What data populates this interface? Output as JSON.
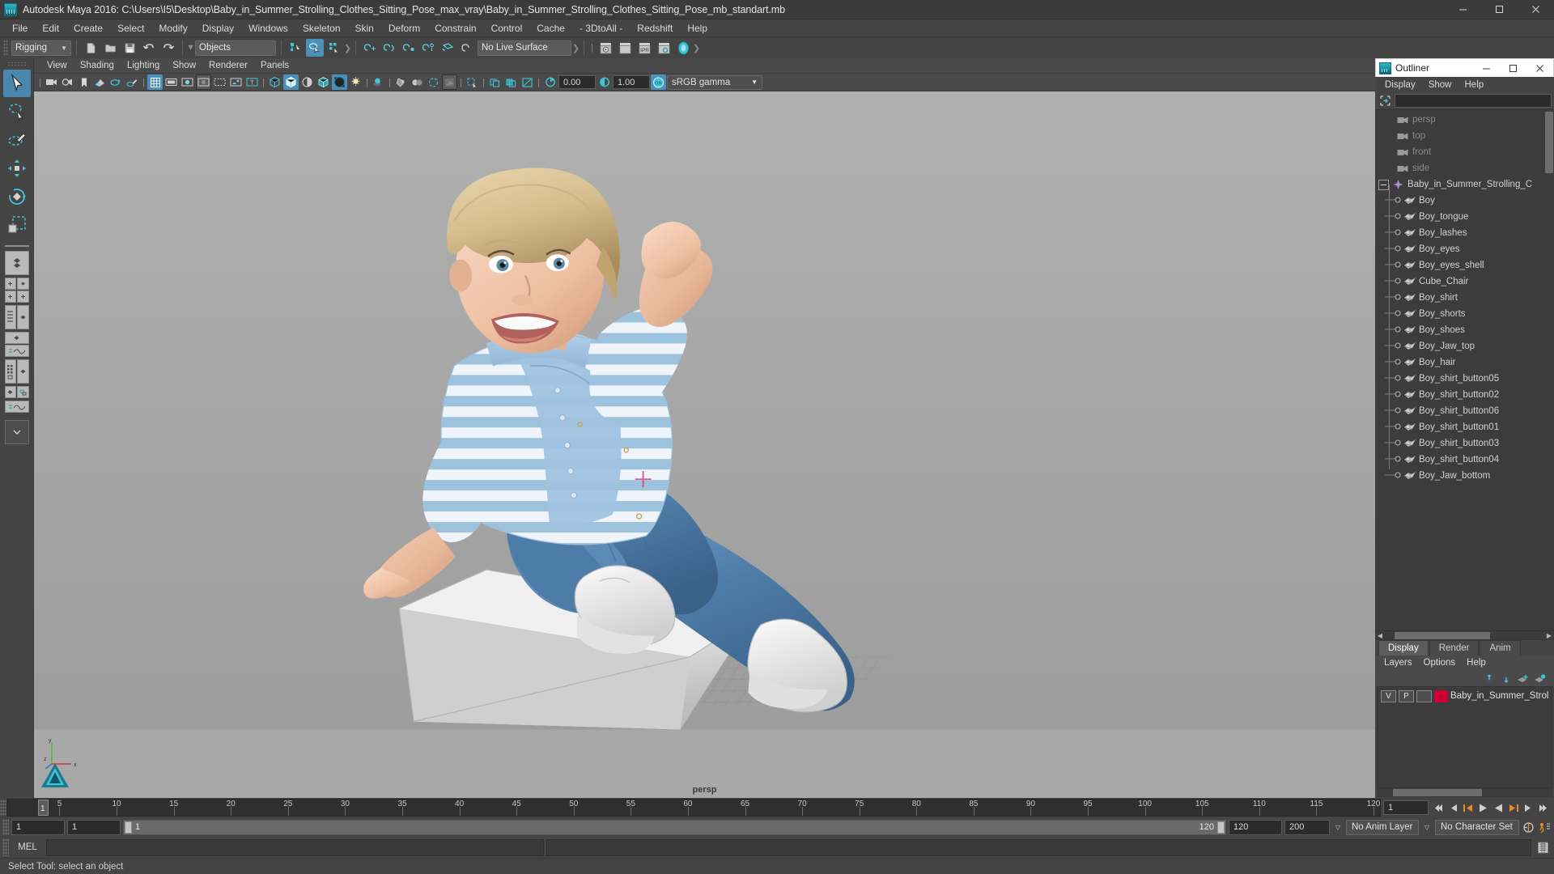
{
  "titlebar": {
    "title": "Autodesk Maya 2016: C:\\Users\\I5\\Desktop\\Baby_in_Summer_Strolling_Clothes_Sitting_Pose_max_vray\\Baby_in_Summer_Strolling_Clothes_Sitting_Pose_mb_standart.mb",
    "minimize": "–",
    "maximize": "❐",
    "close": "✕"
  },
  "menubar": {
    "items": [
      "File",
      "Edit",
      "Create",
      "Select",
      "Modify",
      "Display",
      "Windows",
      "Skeleton",
      "Skin",
      "Deform",
      "Constrain",
      "Control",
      "Cache",
      "- 3DtoAll -",
      "Redshift",
      "Help"
    ]
  },
  "statusbar": {
    "menuset": "Rigging",
    "selection_mask": "Objects",
    "live_surface": "No Live Surface",
    "icons": [
      "new-scene-icon",
      "open-scene-icon",
      "save-scene-icon",
      "undo-icon",
      "redo-icon",
      "select-by-hierarchy-icon",
      "select-by-object-icon",
      "select-by-component-icon",
      "snap-to-grid-icon",
      "snap-to-curve-icon",
      "snap-to-point-icon",
      "snap-to-projected-center-icon",
      "snap-to-view-plane-icon",
      "make-live-icon",
      "render-current-frame-icon",
      "render-sequence-icon",
      "ipr-render-icon",
      "render-settings-icon",
      "hypershade-icon"
    ]
  },
  "toolbox": {
    "tools": [
      {
        "name": "select-tool",
        "selected": true
      },
      {
        "name": "lasso-select-tool",
        "selected": false
      },
      {
        "name": "paint-select-tool",
        "selected": false
      },
      {
        "name": "move-tool",
        "selected": false
      },
      {
        "name": "rotate-tool",
        "selected": false
      },
      {
        "name": "scale-tool",
        "selected": false
      },
      {
        "name": "last-tool-used",
        "selected": false
      }
    ],
    "layouts": [
      "single-perspective-layout",
      "four-view-layout",
      "outliner-persp-layout",
      "persp-graph-layout",
      "hypershade-persp-layout",
      "persp-graph-hypergraph-layout"
    ]
  },
  "viewport": {
    "panel_menus": [
      "View",
      "Shading",
      "Lighting",
      "Show",
      "Renderer",
      "Panels"
    ],
    "camera_label": "persp",
    "exposure": "0.00",
    "gamma": "1.00",
    "color_management": "sRGB gamma",
    "toolbar_icons": [
      "select-camera-icon",
      "camera-attributes-icon",
      "bookmark-icon",
      "image-plane-icon",
      "2d-pan-zoom-icon",
      "grease-pencil-icon",
      "grid-toggle-icon",
      "film-gate-icon",
      "resolution-gate-icon",
      "gate-mask-icon",
      "field-chart-icon",
      "safe-action-icon",
      "safe-title-icon",
      "wireframe-icon",
      "smooth-shade-all-icon",
      "shade-selected-icon",
      "wireframe-on-shaded-icon",
      "textured-icon",
      "use-default-lighting-icon",
      "shadows-icon",
      "screen-space-ao-icon",
      "motion-blur-icon",
      "multisample-icon",
      "isolate-select-icon",
      "xray-icon",
      "xray-joints-icon",
      "xray-active-components-icon",
      "exposure-icon",
      "gamma-icon",
      "color-management-toggle-icon"
    ]
  },
  "outliner": {
    "window_title": "Outliner",
    "menus": [
      "Display",
      "Show",
      "Help"
    ],
    "search_value": "",
    "search_placeholder": "",
    "filter_icon": "outliner-filter-icon",
    "items": [
      {
        "label": "persp",
        "icon": "camera-icon",
        "type": "camera",
        "dim": true,
        "indent": 1,
        "expandable": false
      },
      {
        "label": "top",
        "icon": "camera-icon",
        "type": "camera",
        "dim": true,
        "indent": 1,
        "expandable": false
      },
      {
        "label": "front",
        "icon": "camera-icon",
        "type": "camera",
        "dim": true,
        "indent": 1,
        "expandable": false
      },
      {
        "label": "side",
        "icon": "camera-icon",
        "type": "camera",
        "dim": true,
        "indent": 1,
        "expandable": false
      },
      {
        "label": "Baby_in_Summer_Strolling_C",
        "icon": "group-icon",
        "type": "group",
        "dim": false,
        "indent": 0,
        "expandable": true
      },
      {
        "label": "Boy",
        "icon": "mesh-icon",
        "type": "mesh",
        "dim": false,
        "indent": 2,
        "expandable": false
      },
      {
        "label": "Boy_tongue",
        "icon": "mesh-icon",
        "type": "mesh",
        "dim": false,
        "indent": 2,
        "expandable": false
      },
      {
        "label": "Boy_lashes",
        "icon": "mesh-icon",
        "type": "mesh",
        "dim": false,
        "indent": 2,
        "expandable": false
      },
      {
        "label": "Boy_eyes",
        "icon": "mesh-icon",
        "type": "mesh",
        "dim": false,
        "indent": 2,
        "expandable": false
      },
      {
        "label": "Boy_eyes_shell",
        "icon": "mesh-icon",
        "type": "mesh",
        "dim": false,
        "indent": 2,
        "expandable": false
      },
      {
        "label": "Cube_Chair",
        "icon": "mesh-icon",
        "type": "mesh",
        "dim": false,
        "indent": 2,
        "expandable": false
      },
      {
        "label": "Boy_shirt",
        "icon": "mesh-icon",
        "type": "mesh",
        "dim": false,
        "indent": 2,
        "expandable": false
      },
      {
        "label": "Boy_shorts",
        "icon": "mesh-icon",
        "type": "mesh",
        "dim": false,
        "indent": 2,
        "expandable": false
      },
      {
        "label": "Boy_shoes",
        "icon": "mesh-icon",
        "type": "mesh",
        "dim": false,
        "indent": 2,
        "expandable": false
      },
      {
        "label": "Boy_Jaw_top",
        "icon": "mesh-icon",
        "type": "mesh",
        "dim": false,
        "indent": 2,
        "expandable": false
      },
      {
        "label": "Boy_hair",
        "icon": "mesh-icon",
        "type": "mesh",
        "dim": false,
        "indent": 2,
        "expandable": false
      },
      {
        "label": "Boy_shirt_button05",
        "icon": "mesh-icon",
        "type": "mesh",
        "dim": false,
        "indent": 2,
        "expandable": false
      },
      {
        "label": "Boy_shirt_button02",
        "icon": "mesh-icon",
        "type": "mesh",
        "dim": false,
        "indent": 2,
        "expandable": false
      },
      {
        "label": "Boy_shirt_button06",
        "icon": "mesh-icon",
        "type": "mesh",
        "dim": false,
        "indent": 2,
        "expandable": false
      },
      {
        "label": "Boy_shirt_button01",
        "icon": "mesh-icon",
        "type": "mesh",
        "dim": false,
        "indent": 2,
        "expandable": false
      },
      {
        "label": "Boy_shirt_button03",
        "icon": "mesh-icon",
        "type": "mesh",
        "dim": false,
        "indent": 2,
        "expandable": false
      },
      {
        "label": "Boy_shirt_button04",
        "icon": "mesh-icon",
        "type": "mesh",
        "dim": false,
        "indent": 2,
        "expandable": false
      },
      {
        "label": "Boy_Jaw_bottom",
        "icon": "mesh-icon",
        "type": "mesh",
        "dim": false,
        "indent": 2,
        "expandable": false
      }
    ]
  },
  "layer_editor": {
    "tabs": [
      {
        "label": "Display",
        "active": true
      },
      {
        "label": "Render",
        "active": false
      },
      {
        "label": "Anim",
        "active": false
      }
    ],
    "menus": [
      "Layers",
      "Options",
      "Help"
    ],
    "tool_icons": [
      "move-layer-up-icon",
      "move-layer-down-icon",
      "new-layer-icon",
      "new-layer-from-selected-icon"
    ],
    "columns": [
      "V",
      "P",
      ""
    ],
    "rows": [
      {
        "visible": "V",
        "playback": "P",
        "state": "",
        "color": "#cc0033",
        "name": "Baby_in_Summer_Strol"
      }
    ]
  },
  "timeline": {
    "start_frame": "1",
    "end_frame": "120",
    "current_frame": "1",
    "tick_labels": [
      "5",
      "10",
      "15",
      "20",
      "25",
      "30",
      "35",
      "40",
      "45",
      "50",
      "55",
      "60",
      "65",
      "70",
      "75",
      "80",
      "85",
      "90",
      "95",
      "100",
      "105",
      "110",
      "115",
      "120"
    ],
    "playback_icons": [
      "go-to-start-icon",
      "step-back-frame-icon",
      "step-back-key-icon",
      "play-backwards-icon",
      "play-forwards-icon",
      "step-forward-key-icon",
      "step-forward-frame-icon",
      "go-to-end-icon"
    ]
  },
  "range_slider": {
    "anim_start": "1",
    "playback_start": "1",
    "slider_start": "1",
    "slider_end": "120",
    "playback_end": "120",
    "anim_end": "200",
    "anim_layer": "No Anim Layer",
    "character_set": "No Character Set",
    "auto_key_icon": "auto-keyframe-icon",
    "anim_prefs_icon": "animation-preferences-icon"
  },
  "command_line": {
    "language_label": "MEL",
    "input_value": "",
    "output_value": "",
    "script_editor_icon": "script-editor-icon"
  },
  "help_line": {
    "text": "Select Tool: select an object"
  },
  "colors": {
    "accent": "#4a90b8",
    "window_bg": "#444444",
    "panel_bg": "#3c3c3c",
    "viewport_bg": "#a8a8a8",
    "layer_swatch": "#cc0033"
  }
}
